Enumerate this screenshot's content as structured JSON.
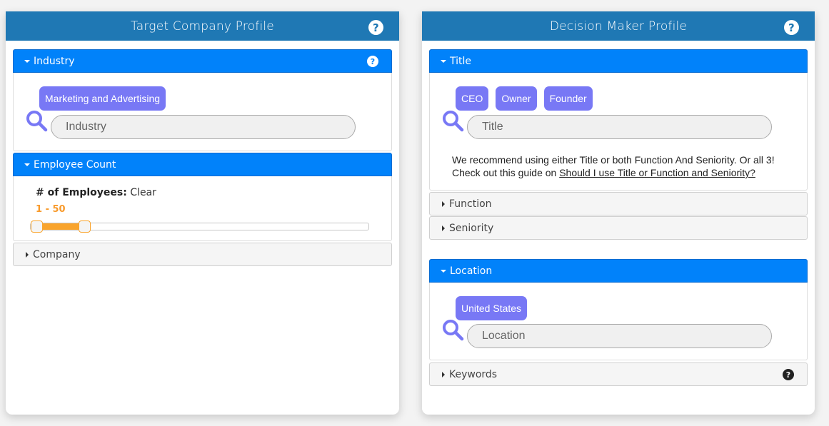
{
  "left_card": {
    "title": "Target Company Profile",
    "help_icon": "question-circle-icon",
    "industry": {
      "label": "Industry",
      "expanded": true,
      "chips": [
        "Marketing and Advertising"
      ],
      "placeholder": "Industry"
    },
    "employee_count": {
      "label": "Employee Count",
      "expanded": true,
      "field_label": "# of Employees:",
      "clear_label": "Clear",
      "range_text": "1 - 50",
      "range_start_fraction": 0.017,
      "range_end_fraction": 0.158
    },
    "company": {
      "label": "Company",
      "expanded": false
    }
  },
  "right_card": {
    "title": "Decision Maker Profile",
    "help_icon": "question-circle-icon",
    "title_section": {
      "label": "Title",
      "expanded": true,
      "chips": [
        "CEO",
        "Owner",
        "Founder"
      ],
      "placeholder": "Title",
      "hint_line1": "We recommend using either Title or both Function And Seniority. Or all 3!",
      "hint_line2_prefix": "Check out this guide on ",
      "hint_link": "Should I use Title or Function and Seniority?"
    },
    "function": {
      "label": "Function",
      "expanded": false
    },
    "seniority": {
      "label": "Seniority",
      "expanded": false
    },
    "location": {
      "label": "Location",
      "expanded": true,
      "chips": [
        "United States"
      ],
      "placeholder": "Location"
    },
    "keywords": {
      "label": "Keywords",
      "expanded": false
    }
  },
  "help_glyph": "?",
  "colors": {
    "card_header": "#1f78b4",
    "section_open": "#0182fa",
    "chip": "#7878f5",
    "slider_accent": "#f9a42c"
  }
}
